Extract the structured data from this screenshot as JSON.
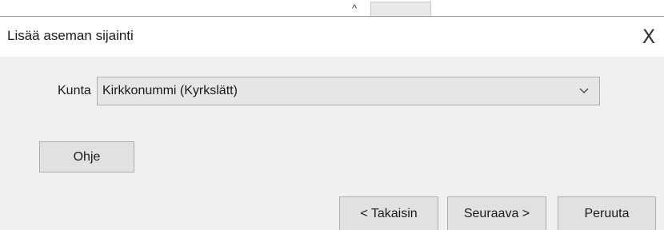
{
  "background": {
    "caret_glyph": "^"
  },
  "dialog": {
    "title": "Lisää aseman sijainti",
    "close_glyph": "X",
    "municipality": {
      "label": "Kunta",
      "selected": "Kirkkonummi (Kyrkslätt)"
    },
    "buttons": {
      "help": "Ohje",
      "back": "< Takaisin",
      "next": "Seuraava >",
      "cancel": "Peruuta"
    }
  },
  "icons": {
    "dropdown": "chevron-down-icon",
    "close": "close-icon"
  },
  "colors": {
    "dialog_bg": "#f0f0f0",
    "button_bg": "#e1e1e1",
    "border": "#adadad"
  }
}
